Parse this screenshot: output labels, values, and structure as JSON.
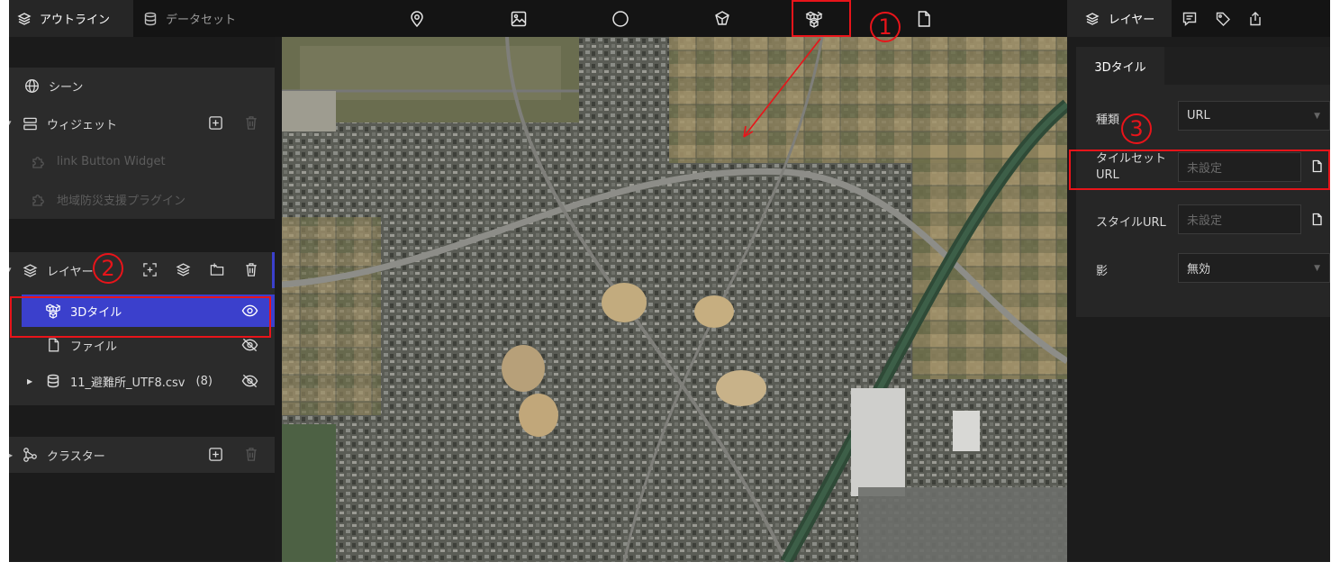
{
  "topbar": {
    "tab_outline": "アウトライン",
    "tab_dataset": "データセット",
    "tools": [
      "marker-tool",
      "photo-overlay-tool",
      "sphere-tool",
      "model-tool",
      "3d-tiles-tool",
      "file-tool"
    ]
  },
  "left": {
    "scene": "シーン",
    "widget": "ウィジェット",
    "widget_items": [
      "link Button Widget",
      "地域防災支援プラグイン"
    ],
    "layer": "レイヤー",
    "layers": [
      {
        "label": "3Dタイル",
        "selected": true,
        "visible": true
      },
      {
        "label": "ファイル",
        "selected": false,
        "visible": false
      },
      {
        "label": "11_避難所_UTF8.csv",
        "count": "(8)",
        "selected": false,
        "visible": false
      }
    ],
    "cluster": "クラスター"
  },
  "right": {
    "tab_layer": "レイヤー",
    "section_tab": "3Dタイル",
    "fields": {
      "type_label": "種類",
      "type_value": "URL",
      "tileset_label_1": "タイルセット",
      "tileset_label_2": "URL",
      "tileset_placeholder": "未設定",
      "style_label": "スタイルURL",
      "style_placeholder": "未設定",
      "shadow_label": "影",
      "shadow_value": "無効"
    }
  },
  "annotations": {
    "marker_1": "1",
    "marker_2": "2",
    "marker_3": "3"
  },
  "colors": {
    "accent": "#3b40cc",
    "annotation": "#e8141a"
  }
}
